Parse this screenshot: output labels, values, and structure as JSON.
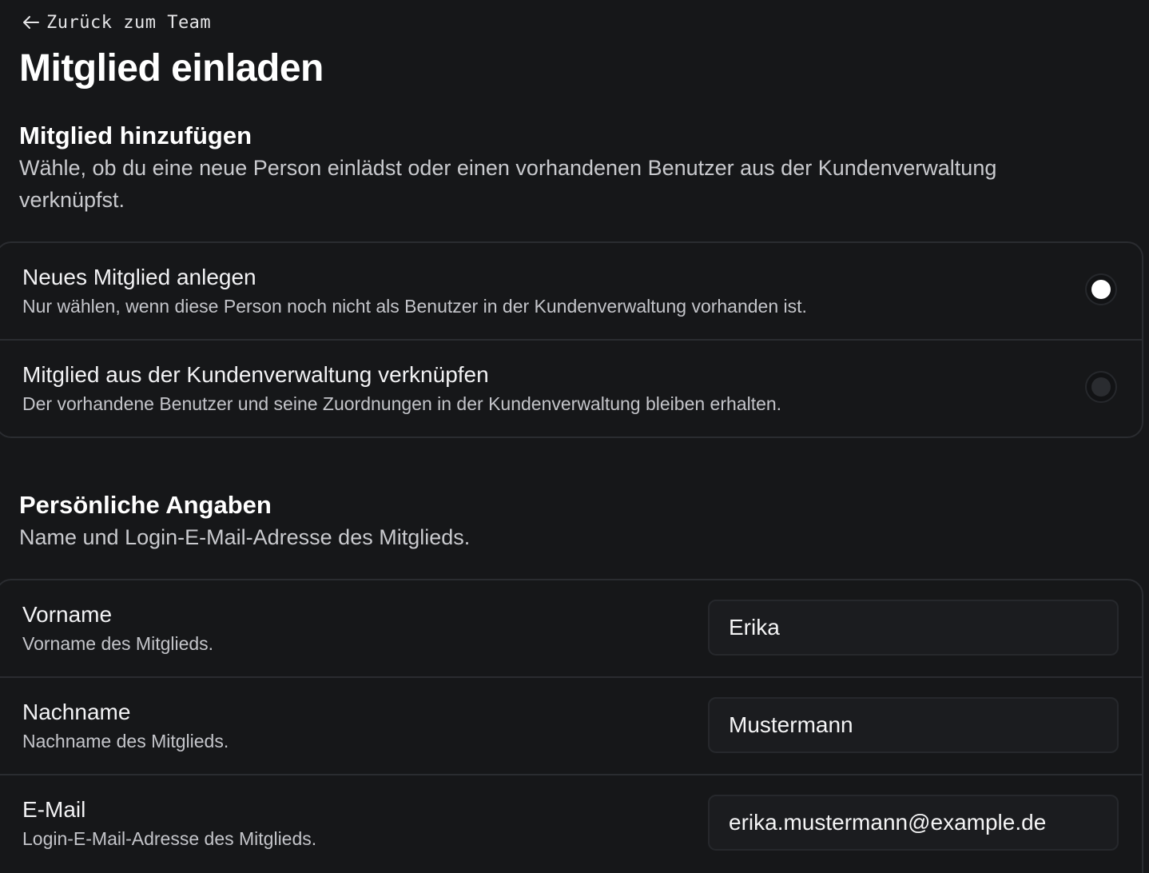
{
  "back_link": {
    "label": "Zurück zum Team",
    "icon": "arrow-left-icon"
  },
  "page_title": "Mitglied einladen",
  "add_section": {
    "title": "Mitglied hinzufügen",
    "description": "Wähle, ob du eine neue Person einlädst oder einen vorhandenen Benutzer aus der Kundenverwaltung verknüpfst.",
    "options": [
      {
        "label": "Neues Mitglied anlegen",
        "description": "Nur wählen, wenn diese Person noch nicht als Benutzer in der Kundenverwaltung vorhanden ist.",
        "selected": true
      },
      {
        "label": "Mitglied aus der Kundenverwaltung verknüpfen",
        "description": "Der vorhandene Benutzer und seine Zuordnungen in der Kundenverwaltung bleiben erhalten.",
        "selected": false
      }
    ]
  },
  "personal_section": {
    "title": "Persönliche Angaben",
    "description": "Name und Login-E-Mail-Adresse des Mitglieds.",
    "fields": [
      {
        "label": "Vorname",
        "description": "Vorname des Mitglieds.",
        "value": "Erika"
      },
      {
        "label": "Nachname",
        "description": "Nachname des Mitglieds.",
        "value": "Mustermann"
      },
      {
        "label": "E-Mail",
        "description": "Login-E-Mail-Adresse des Mitglieds.",
        "value": "erika.mustermann@example.de"
      }
    ]
  },
  "colors": {
    "background": "#161719",
    "border": "#2a2c30",
    "text_primary": "#ffffff",
    "text_secondary": "#c4c5ca"
  }
}
